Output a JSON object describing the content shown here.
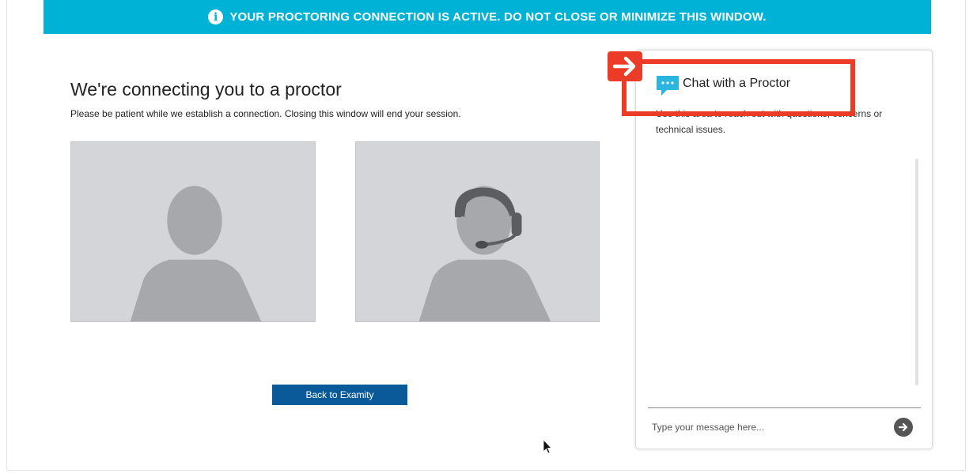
{
  "banner": {
    "icon": "info-icon",
    "text": "YOUR PROCTORING CONNECTION IS ACTIVE. DO NOT CLOSE OR MINIMIZE THIS WINDOW.",
    "color": "#00b3d6"
  },
  "main": {
    "title": "We're connecting you to a proctor",
    "subtitle": "Please be patient while we establish a connection. Closing this window will end your session.",
    "panels": [
      {
        "icon": "user-avatar-icon"
      },
      {
        "icon": "proctor-headset-icon"
      }
    ],
    "back_button_label": "Back to Examity",
    "button_color": "#0a5a99"
  },
  "chat": {
    "icon": "chat-bubble-icon",
    "title": "Chat with a Proctor",
    "description": "Use this area to reach out with questions, concerns or technical issues.",
    "input_placeholder": "Type your message here...",
    "input_value": "",
    "send_icon": "arrow-right-circle-icon"
  },
  "annotation": {
    "color": "#ec3b26",
    "arrow_icon": "arrow-right-icon"
  }
}
